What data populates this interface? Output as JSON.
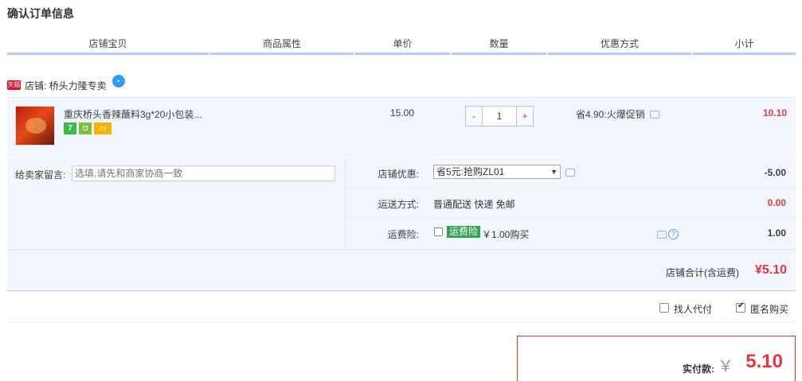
{
  "page": {
    "title": "确认订单信息"
  },
  "columns": [
    "店铺宝贝",
    "商品属性",
    "单价",
    "数量",
    "优惠方式",
    "小计"
  ],
  "shop": {
    "badge": "天猫",
    "label": "店铺: 桥头力隆专卖"
  },
  "item": {
    "title": "重庆桥头香辣蘸料3g*20小包装...",
    "price": "15.00",
    "qty_minus": "-",
    "qty": "1",
    "qty_plus": "+",
    "promo": "省4.90:火爆促销",
    "subtotal": "10.10",
    "service_icons": [
      "seven-day-icon",
      "shield-icon",
      "card-icon"
    ]
  },
  "options": {
    "message_label": "给卖家留言:",
    "message_placeholder": "选填,请先和商家协商一致",
    "shop_discount_label": "店铺优惠:",
    "shop_discount_selected": "省5元:抢购ZL01",
    "shop_discount_amount": "-5.00",
    "shipping_label": "运送方式:",
    "shipping_value": "普通配送 快递 免邮",
    "shipping_amount": "0.00",
    "insurance_label": "运费险:",
    "insurance_tag": "运费险",
    "insurance_price": "￥1.00购买",
    "insurance_amount": "1.00"
  },
  "shop_total": {
    "label": "店铺合计(含运费)",
    "value": "¥5.10"
  },
  "checkout_options": {
    "proxy_pay": "找人代付",
    "anonymous": "匿名购买",
    "anonymous_checked": true
  },
  "payment": {
    "label": "实付款:",
    "currency": "￥",
    "value": "5.10"
  },
  "colors": {
    "accent_red": "#e4393c",
    "row_bg": "#f2f7ff",
    "header_line": "#b2d1ff"
  }
}
